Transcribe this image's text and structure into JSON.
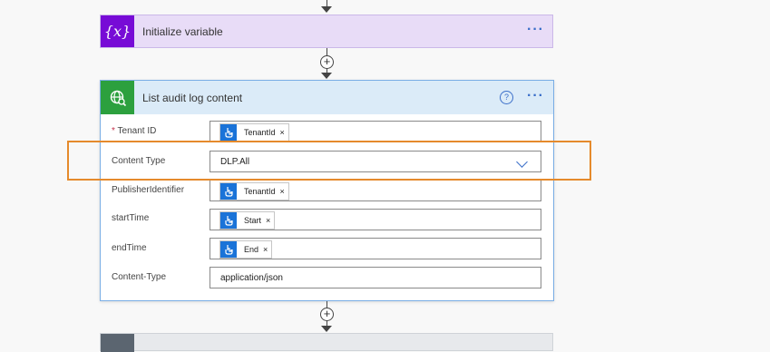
{
  "variable_step": {
    "title": "Initialize variable",
    "icon": "variable-icon",
    "more": "···"
  },
  "audit_step": {
    "title": "List audit log content",
    "icon": "globe-search-icon",
    "help": "?",
    "more": "···",
    "fields": {
      "tenant": {
        "required_mark": "*",
        "label": "Tenant ID",
        "token": "TenantId"
      },
      "content_type": {
        "label": "Content Type",
        "value": "DLP.All"
      },
      "publisher": {
        "label": "PublisherIdentifier",
        "token": "TenantId"
      },
      "start": {
        "label": "startTime",
        "token": "Start"
      },
      "end": {
        "label": "endTime",
        "token": "End"
      },
      "content_type_header": {
        "label": "Content-Type",
        "value": "application/json"
      }
    },
    "token_remove": "×"
  },
  "connector": {
    "plus": "+"
  },
  "colors": {
    "variable_accent": "#770bd6",
    "audit_accent": "#2ca03e",
    "highlight": "#e58a2c",
    "token": "#1a73d8"
  }
}
